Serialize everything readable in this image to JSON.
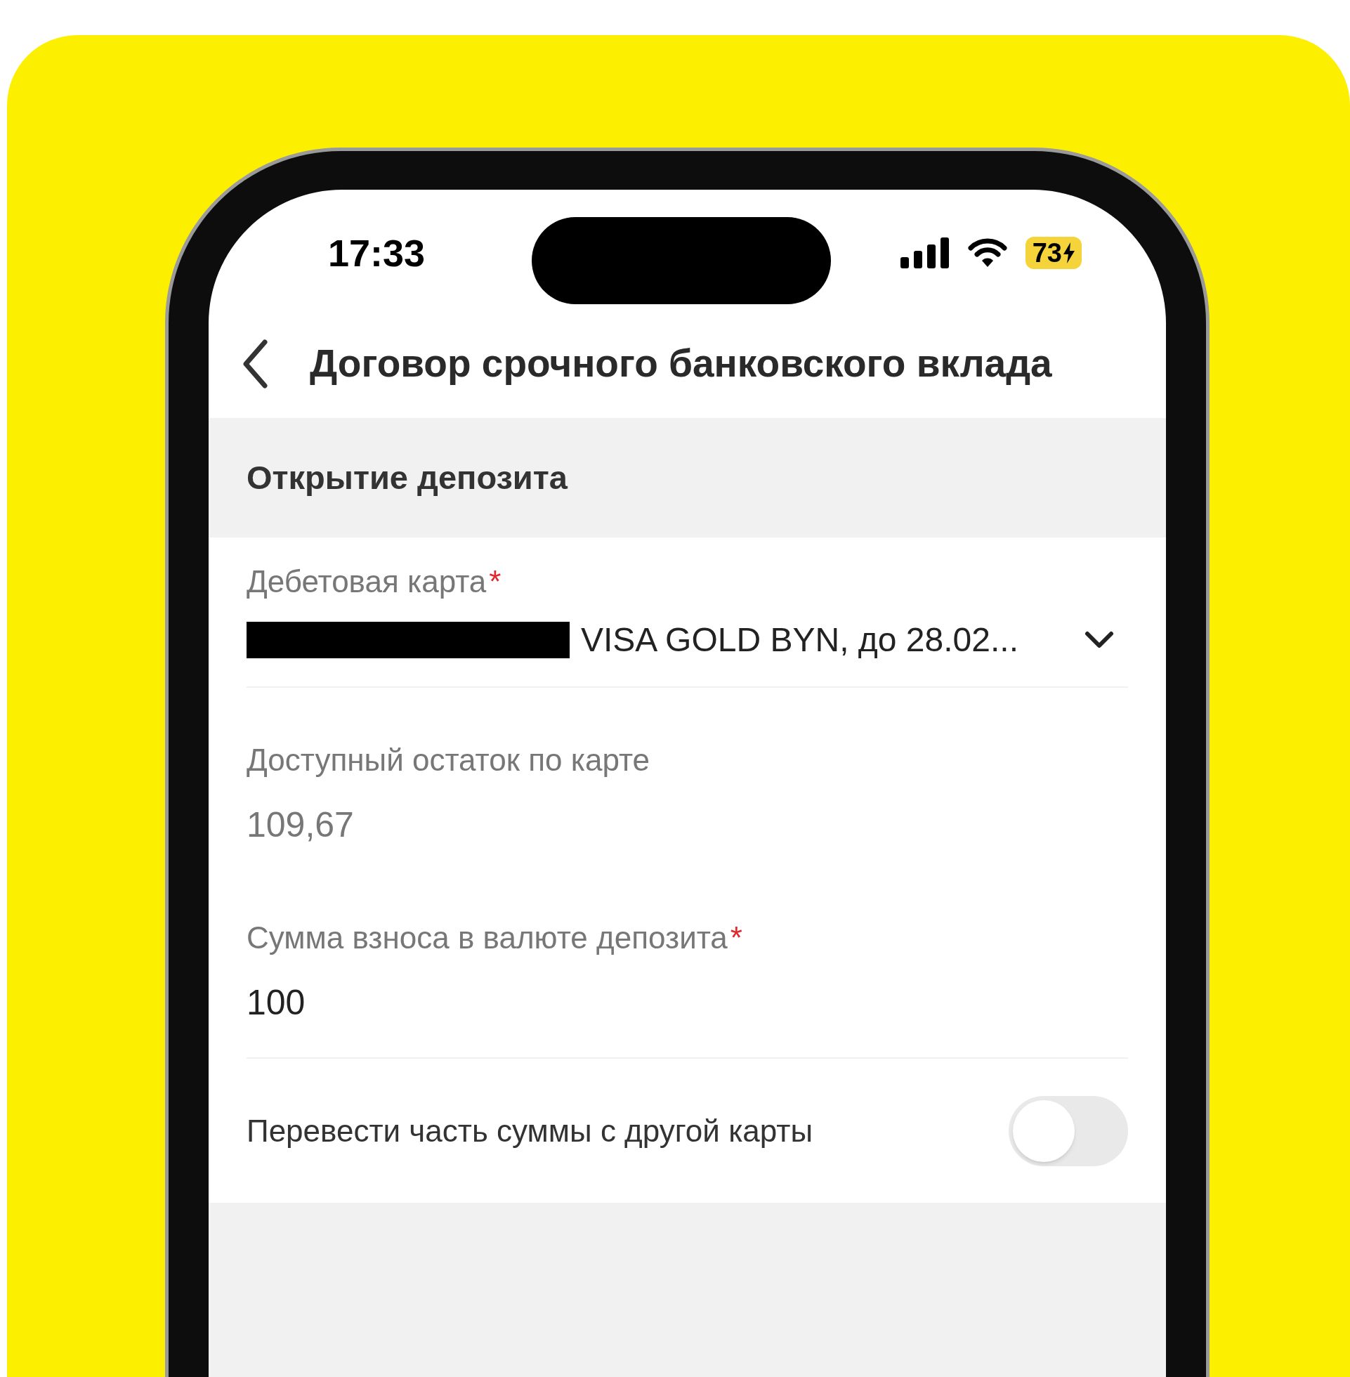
{
  "status_bar": {
    "time": "17:33",
    "battery": "73"
  },
  "header": {
    "title": "Договор срочного банковского вклада"
  },
  "section": {
    "title": "Открытие депозита"
  },
  "card_field": {
    "label": "Дебетовая карта",
    "required": true,
    "required_mark": "*",
    "value": "VISA GOLD BYN, до 28.02..."
  },
  "balance": {
    "label": "Доступный остаток по карте",
    "value": "109,67"
  },
  "amount_field": {
    "label": "Сумма взноса в валюте депозита",
    "required": true,
    "required_mark": "*",
    "value": "100"
  },
  "transfer_toggle": {
    "label": "Перевести часть суммы с другой карты",
    "on": false
  }
}
